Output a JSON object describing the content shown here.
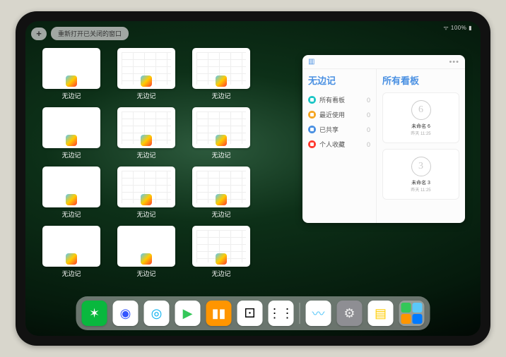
{
  "status": {
    "text": "100%"
  },
  "top": {
    "plus": "+",
    "reopen_label": "重新打开已关闭的窗口"
  },
  "apps": {
    "label": "无边记",
    "thumbs": [
      {
        "grid": false
      },
      {
        "grid": true
      },
      {
        "grid": true
      },
      {
        "grid": false
      },
      {
        "grid": true
      },
      {
        "grid": true
      },
      {
        "grid": false
      },
      {
        "grid": true
      },
      {
        "grid": true
      },
      {
        "grid": false
      },
      {
        "grid": false
      },
      {
        "grid": true
      }
    ]
  },
  "preview": {
    "nav_title": "无边记",
    "content_title": "所有看板",
    "items": [
      {
        "label": "所有看板",
        "count": "0",
        "color": "#1ec6c6"
      },
      {
        "label": "最近使用",
        "count": "0",
        "color": "#f5a623"
      },
      {
        "label": "已共享",
        "count": "0",
        "color": "#4a90e2"
      },
      {
        "label": "个人收藏",
        "count": "0",
        "color": "#ff3b30"
      }
    ],
    "boards": [
      {
        "sketch": "6",
        "title": "未命名 6",
        "sub": "昨天 11:25"
      },
      {
        "sketch": "3",
        "title": "未命名 3",
        "sub": "昨天 11:25"
      }
    ]
  },
  "dock": {
    "icons": [
      {
        "name": "wechat-icon",
        "bg": "#09b83e",
        "glyph": "✶",
        "fg": "#fff"
      },
      {
        "name": "quark-icon",
        "bg": "#fff",
        "glyph": "◉",
        "fg": "#3355ff"
      },
      {
        "name": "qqbrowser-icon",
        "bg": "#fff",
        "glyph": "◎",
        "fg": "#00aeef"
      },
      {
        "name": "play-icon",
        "bg": "#fff",
        "glyph": "▶",
        "fg": "#34c759"
      },
      {
        "name": "books-icon",
        "bg": "#ff9500",
        "glyph": "▮▮",
        "fg": "#fff"
      },
      {
        "name": "dice-icon",
        "bg": "#fff",
        "glyph": "⚀",
        "fg": "#000"
      },
      {
        "name": "nodes-icon",
        "bg": "#fff",
        "glyph": "⋮⋮",
        "fg": "#000"
      }
    ],
    "recent": [
      {
        "name": "freeform-icon",
        "bg": "#fff",
        "glyph": "〰",
        "fg": "#5ac8fa"
      },
      {
        "name": "settings-icon",
        "bg": "#8e8e93",
        "glyph": "⚙",
        "fg": "#eee"
      },
      {
        "name": "notes-icon",
        "bg": "#fff",
        "glyph": "▤",
        "fg": "#ffcc00"
      }
    ]
  }
}
